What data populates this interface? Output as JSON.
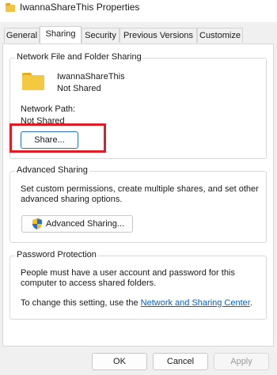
{
  "window": {
    "title": "IwannaShareThis Properties"
  },
  "tabs": [
    {
      "label": "General"
    },
    {
      "label": "Sharing"
    },
    {
      "label": "Security"
    },
    {
      "label": "Previous Versions"
    },
    {
      "label": "Customize"
    }
  ],
  "network_sharing": {
    "group_title": "Network File and Folder Sharing",
    "folder_name": "IwannaShareThis",
    "folder_status": "Not Shared",
    "path_label": "Network Path:",
    "path_value": "Not Shared",
    "share_button": "Share..."
  },
  "advanced_sharing": {
    "group_title": "Advanced Sharing",
    "description_line1": "Set custom permissions, create multiple shares, and set other",
    "description_line2": "advanced sharing options.",
    "button_label": "Advanced Sharing..."
  },
  "password_protection": {
    "group_title": "Password Protection",
    "line1": "People must have a user account and password for this",
    "line2": "computer to access shared folders.",
    "change_prefix": "To change this setting, use the ",
    "link_text": "Network and Sharing Center",
    "change_suffix": "."
  },
  "footer": {
    "ok": "OK",
    "cancel": "Cancel",
    "apply": "Apply"
  },
  "colors": {
    "highlight": "#e01d27",
    "link": "#0a5ec2",
    "folder": "#f5c842"
  }
}
